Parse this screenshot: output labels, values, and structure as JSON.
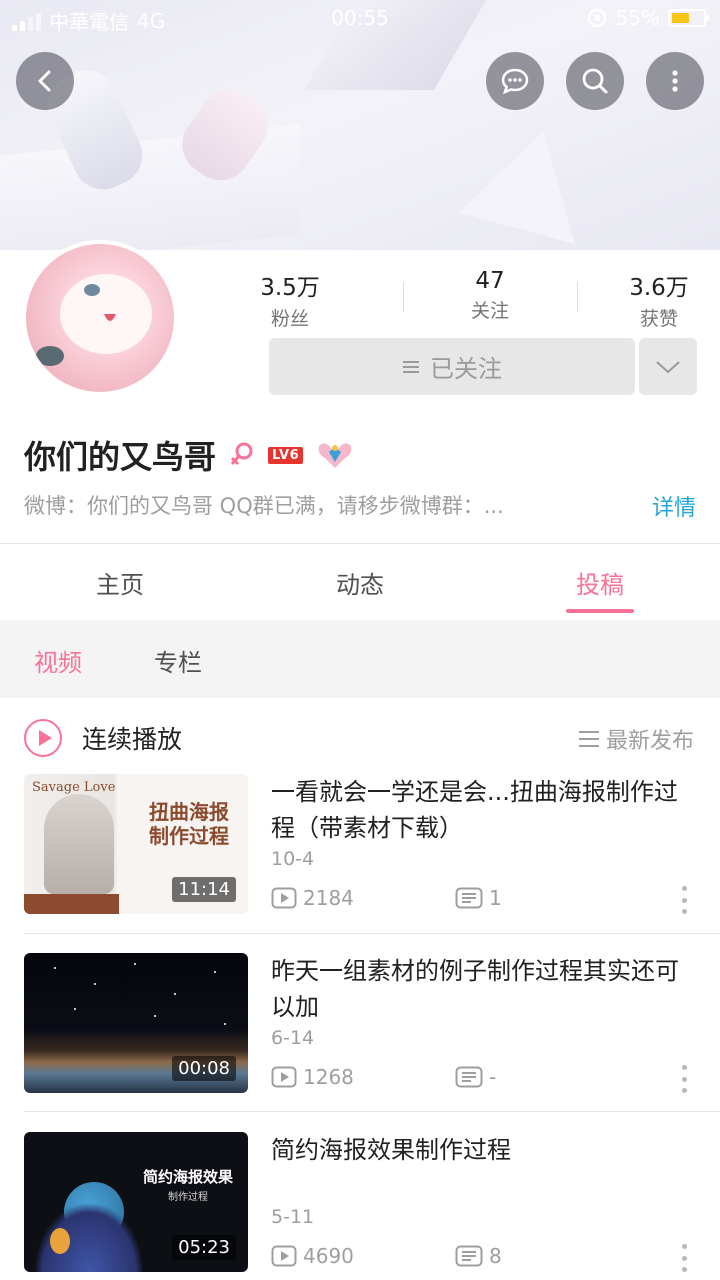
{
  "status_bar": {
    "carrier": "中華電信",
    "network": "4G",
    "time": "00:55",
    "battery": "55%",
    "battery_level": 0.55
  },
  "header_icons": {
    "back": "back-arrow-icon",
    "message": "message-icon",
    "search": "search-icon",
    "more": "more-vertical-icon"
  },
  "profile": {
    "stats": [
      {
        "value": "3.5万",
        "label": "粉丝"
      },
      {
        "value": "47",
        "label": "关注"
      },
      {
        "value": "3.6万",
        "label": "获赞"
      }
    ],
    "follow_label": "已关注",
    "name": "你们的又鸟哥",
    "level_badge": "LV6",
    "bio": "微博：你们的又鸟哥  QQ群已满，请移步微博群：...",
    "detail_link": "详情"
  },
  "tabs": [
    {
      "label": "主页"
    },
    {
      "label": "动态"
    },
    {
      "label": "投稿"
    }
  ],
  "active_tab": "投稿",
  "subtabs": [
    {
      "label": "视频"
    },
    {
      "label": "专栏"
    }
  ],
  "active_subtab": "视频",
  "playlist": {
    "play_all_label": "连续播放",
    "sort_label": "最新发布"
  },
  "videos": [
    {
      "title": "一看就会一学还是会...扭曲海报制作过程（带素材下载）",
      "date": "10-4",
      "views": "2184",
      "comments": "1",
      "duration": "11:14",
      "thumb_text_top": "Savage Love",
      "thumb_text_main": "扭曲海报制作过程"
    },
    {
      "title": "昨天一组素材的例子制作过程其实还可以加",
      "date": "6-14",
      "views": "1268",
      "comments": "-",
      "duration": "00:08"
    },
    {
      "title": "简约海报效果制作过程",
      "date": "5-11",
      "views": "4690",
      "comments": "8",
      "duration": "05:23",
      "thumb_text_main": "简约海报效果",
      "thumb_text_sub": "制作过程"
    }
  ],
  "colors": {
    "accent": "#fb7299",
    "link": "#23a4d9",
    "badge_red": "#e8342f",
    "battery_yellow": "#f5c518"
  }
}
